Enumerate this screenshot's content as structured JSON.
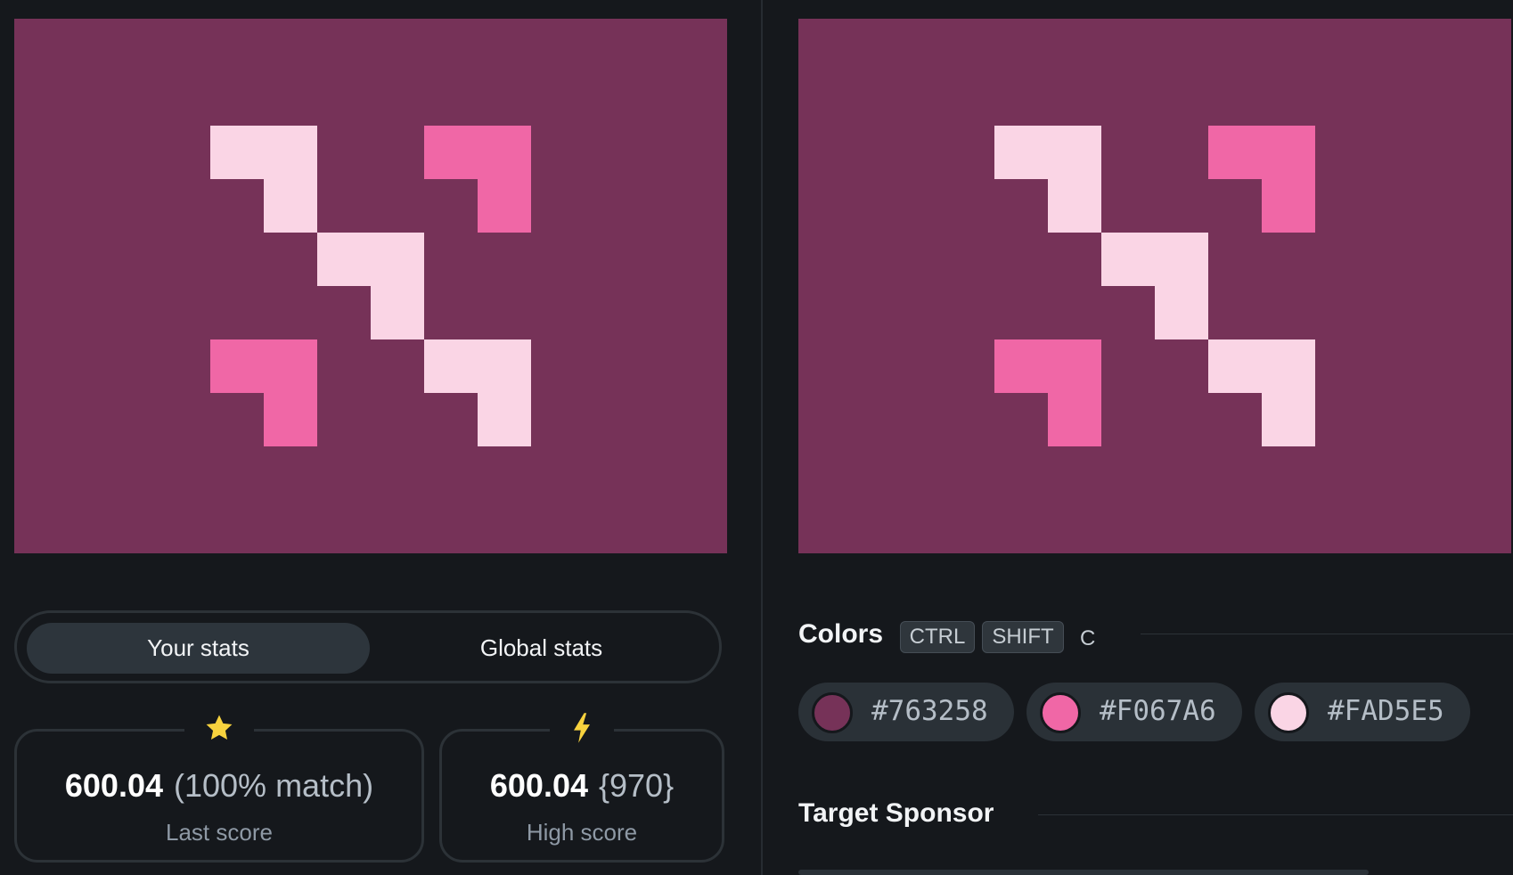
{
  "colors": {
    "background": "#763258",
    "pink": "#F067A6",
    "light": "#FAD5E5"
  },
  "stats_toggle": {
    "your_stats": "Your stats",
    "global_stats": "Global stats"
  },
  "last_score": {
    "icon": "star-icon",
    "value": "600.04",
    "match": "(100% match)",
    "caption": "Last score"
  },
  "high_score": {
    "icon": "lightning-icon",
    "value": "600.04",
    "attempts": "{970}",
    "caption": "High score"
  },
  "colors_section": {
    "title": "Colors",
    "shortcut": [
      "CTRL",
      "SHIFT",
      "C"
    ],
    "swatches": [
      {
        "hex": "#763258",
        "label": "#763258"
      },
      {
        "hex": "#F067A6",
        "label": "#F067A6"
      },
      {
        "hex": "#FAD5E5",
        "label": "#FAD5E5"
      }
    ]
  },
  "sponsor_section": {
    "title": "Target Sponsor"
  }
}
